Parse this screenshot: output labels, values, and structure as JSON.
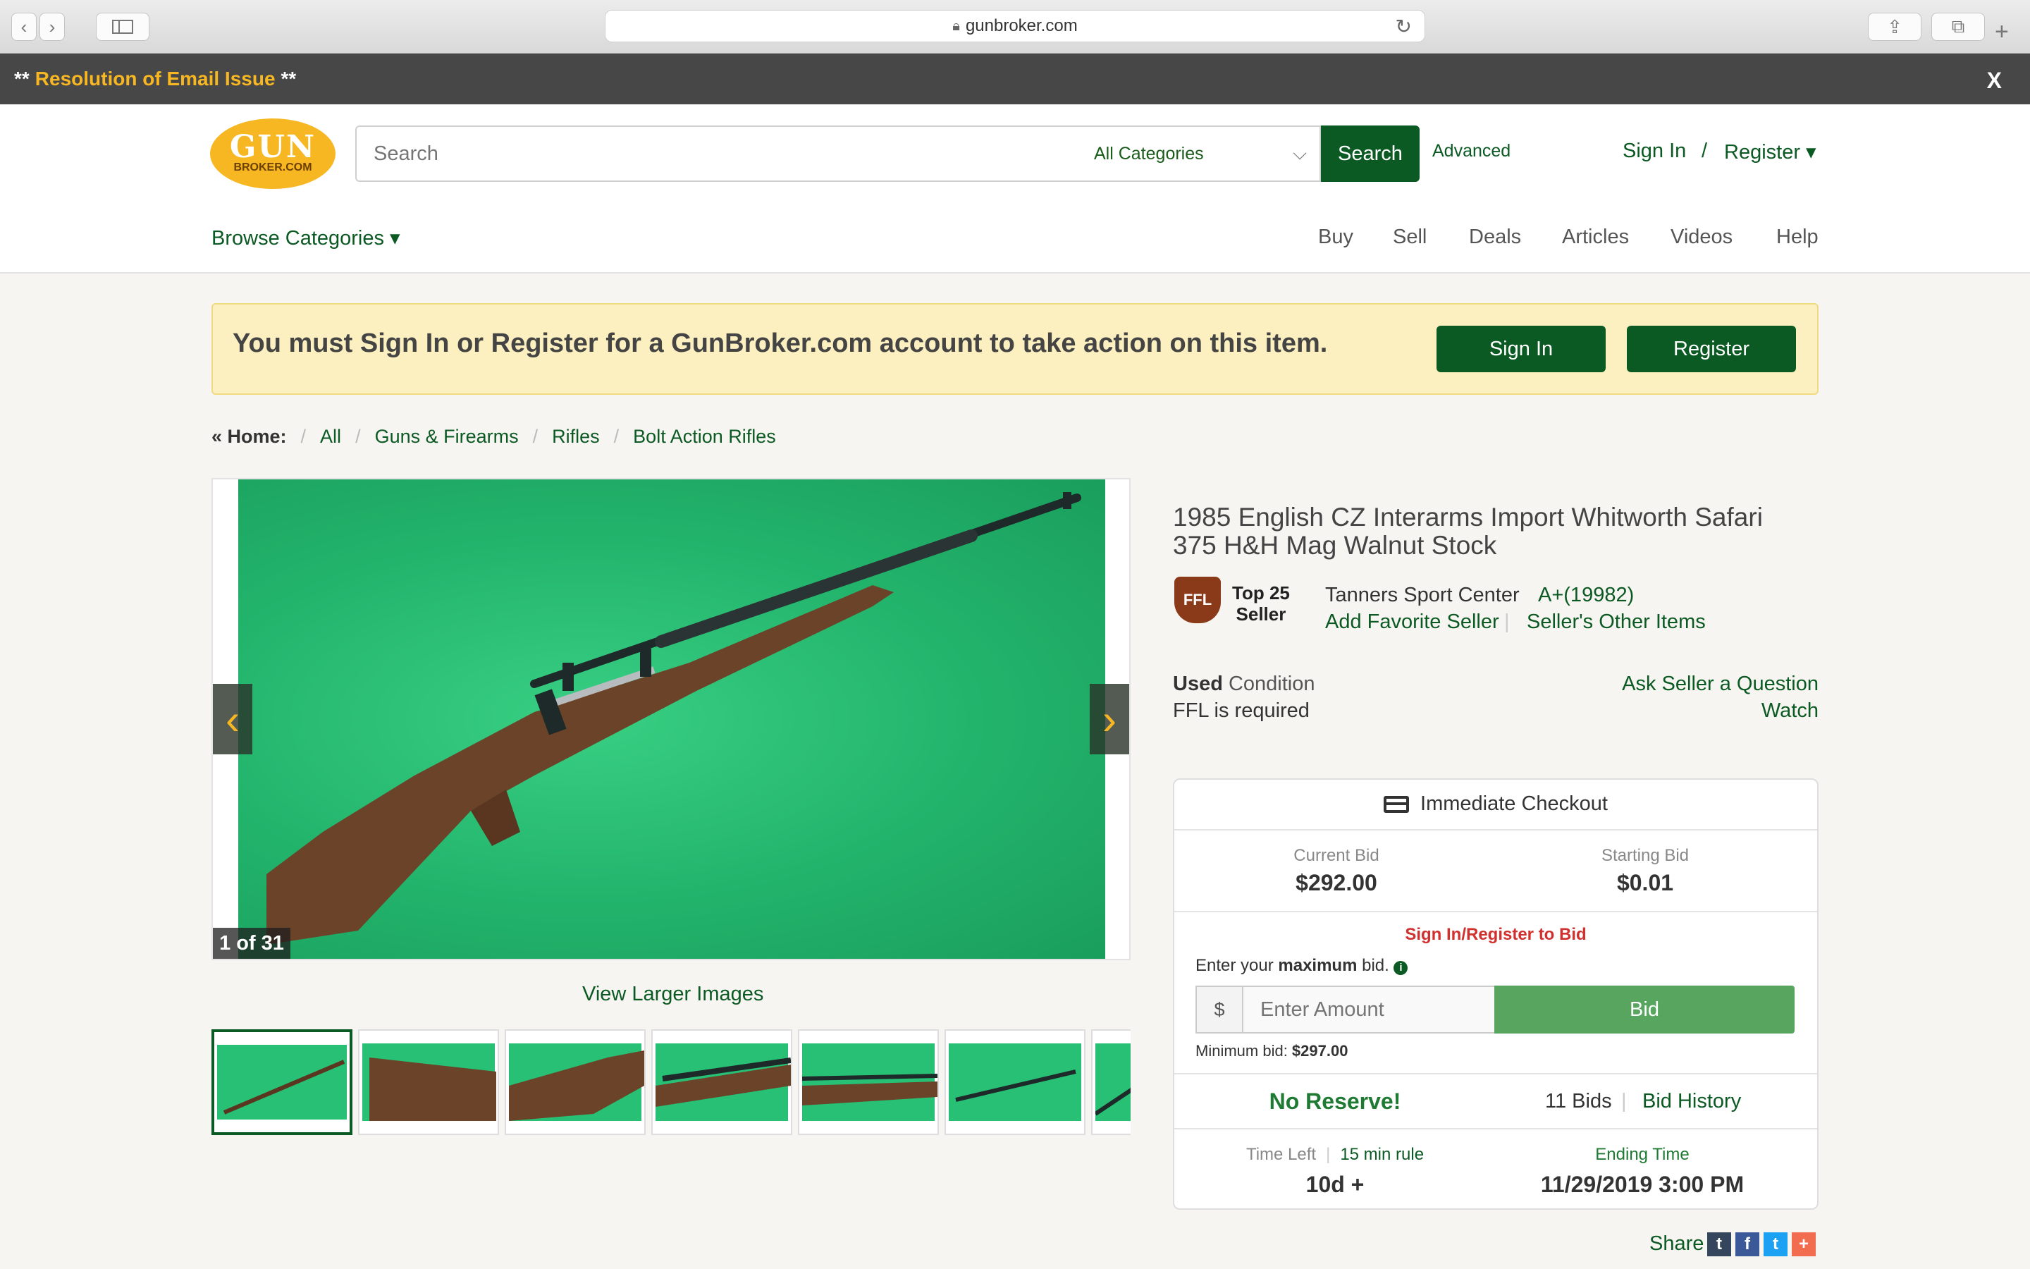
{
  "browser": {
    "url": "gunbroker.com"
  },
  "alert": {
    "prefix": "**",
    "link": "Resolution of Email Issue",
    "suffix": "**",
    "close": "X"
  },
  "header": {
    "logo_line1": "GUN",
    "logo_line2": "BROKER.COM",
    "search_placeholder": "Search",
    "category_selected": "All Categories",
    "search_button": "Search",
    "advanced": "Advanced",
    "sign_in": "Sign In",
    "slash": "/",
    "register": "Register ▾",
    "browse_categories": "Browse Categories ▾",
    "nav": [
      "Buy",
      "Sell",
      "Deals",
      "Articles",
      "Videos",
      "Help"
    ]
  },
  "notice": {
    "text": "You must Sign In or Register for a GunBroker.com account to take action on this item.",
    "sign_in": "Sign In",
    "register": "Register"
  },
  "breadcrumb": {
    "home": "« Home:",
    "items": [
      "All",
      "Guns & Firearms",
      "Rifles",
      "Bolt Action Rifles"
    ]
  },
  "gallery": {
    "counter": "1 of 31",
    "view_larger": "View Larger Images",
    "prev": "‹",
    "next": "›"
  },
  "item": {
    "title": "1985 English CZ Interarms Import Whitworth Safari 375 H&H Mag Walnut Stock",
    "ffl_badge": "FFL",
    "top25_line1": "Top 25",
    "top25_line2": "Seller",
    "seller_name": "Tanners Sport Center",
    "seller_rating": "A+(19982)",
    "add_favorite": "Add Favorite Seller",
    "other_items": "Seller's Other Items",
    "condition_bold": "Used",
    "condition_label": " Condition",
    "ffl_required": "FFL is required",
    "ask_seller": "Ask Seller a Question",
    "watch": "Watch"
  },
  "bid": {
    "checkout": "Immediate Checkout",
    "current_bid_label": "Current Bid",
    "current_bid": "$292.00",
    "starting_bid_label": "Starting Bid",
    "starting_bid": "$0.01",
    "sign_in_to_bid": "Sign In/Register to Bid",
    "enter_prefix": "Enter your ",
    "enter_bold": "maximum",
    "enter_suffix": " bid.",
    "info_icon": "i",
    "currency": "$",
    "amount_placeholder": "Enter Amount",
    "bid_button": "Bid",
    "minimum_label": "Minimum bid: ",
    "minimum_value": "$297.00",
    "no_reserve": "No Reserve!",
    "bids_count": "11 Bids",
    "bid_history": "Bid History",
    "time_left_label": "Time Left",
    "rule": "15 min rule",
    "time_left": "10d +",
    "ending_label": "Ending Time",
    "ending_time": "11/29/2019 3:00 PM"
  },
  "share": {
    "label": "Share",
    "icons": [
      "t",
      "f",
      "t",
      "+"
    ],
    "colors": [
      "#35465c",
      "#3b5998",
      "#1da1f2",
      "#f26c4f"
    ]
  }
}
